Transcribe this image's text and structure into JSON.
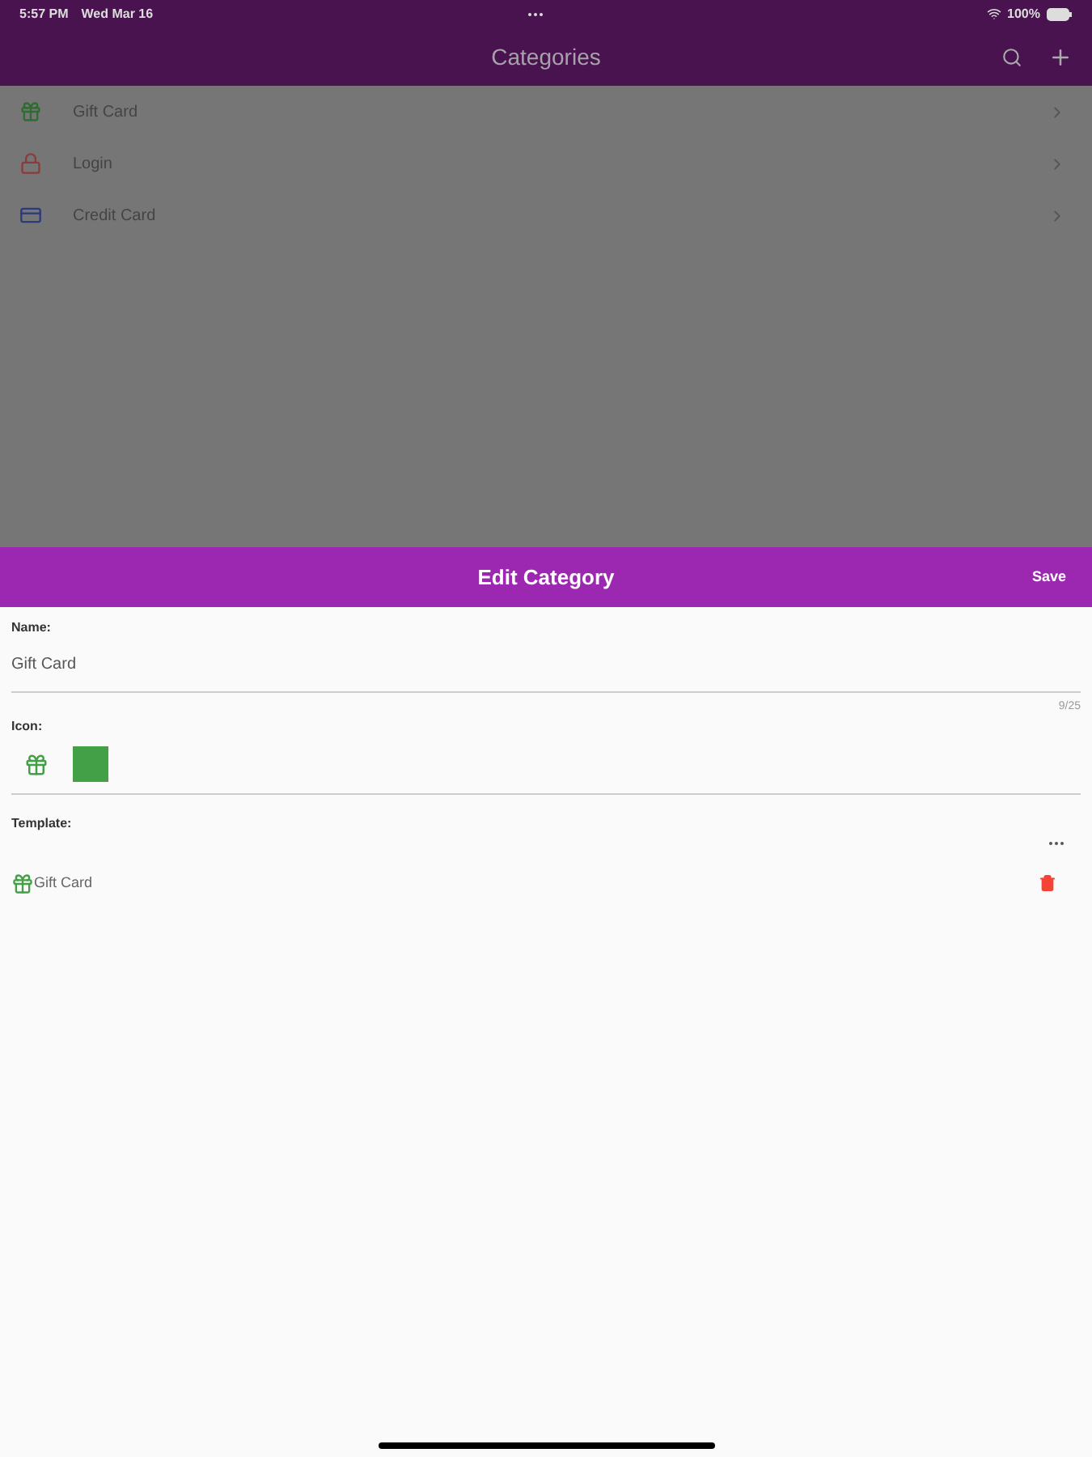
{
  "status_bar": {
    "time": "5:57 PM",
    "date": "Wed Mar 16",
    "battery": "100%"
  },
  "header": {
    "title": "Categories"
  },
  "categories": [
    {
      "kind": "gift",
      "label": "Gift Card"
    },
    {
      "kind": "lock",
      "label": "Login"
    },
    {
      "kind": "card",
      "label": "Credit Card"
    }
  ],
  "sheet": {
    "title": "Edit Category",
    "save": "Save",
    "name_label": "Name:",
    "name_value": "Gift Card",
    "counter": "9/25",
    "icon_label": "Icon:",
    "icon_picker": {
      "kind": "gift",
      "color": "#43a047"
    },
    "template_label": "Template:",
    "template_items": [
      {
        "kind": "gift",
        "label": "Gift Card"
      }
    ]
  }
}
